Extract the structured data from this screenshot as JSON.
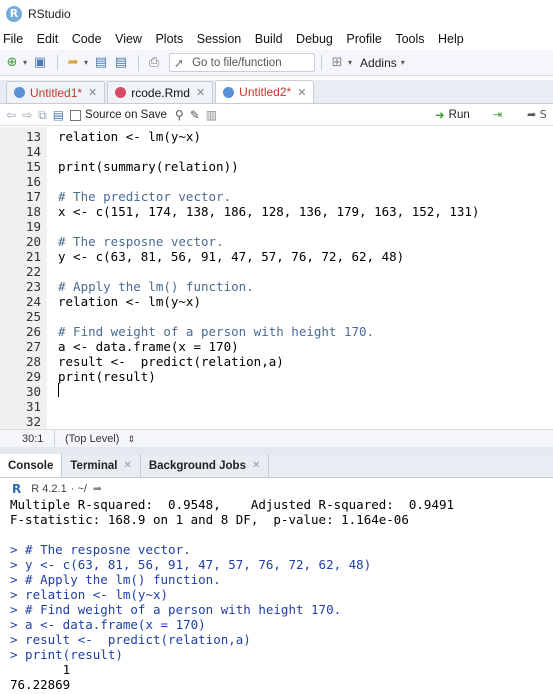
{
  "window": {
    "title": "RStudio"
  },
  "menu": [
    "File",
    "Edit",
    "Code",
    "View",
    "Plots",
    "Session",
    "Build",
    "Debug",
    "Profile",
    "Tools",
    "Help"
  ],
  "toolbar": {
    "goto_placeholder": "Go to file/function",
    "addins_label": "Addins"
  },
  "editor_tabs": [
    {
      "label": "Untitled1*",
      "modified": true
    },
    {
      "label": "rcode.Rmd",
      "modified": false
    },
    {
      "label": "Untitled2*",
      "modified": true
    }
  ],
  "editor_toolbar": {
    "source_on_save": "Source on Save",
    "run_label": "Run",
    "source_label": "S"
  },
  "code_lines": [
    {
      "n": "13",
      "text": "relation <- lm(y~x)",
      "kind": "code"
    },
    {
      "n": "14",
      "text": "",
      "kind": "code"
    },
    {
      "n": "15",
      "text": "print(summary(relation))",
      "kind": "code"
    },
    {
      "n": "16",
      "text": "",
      "kind": "code"
    },
    {
      "n": "17",
      "text": "# The predictor vector.",
      "kind": "comment"
    },
    {
      "n": "18",
      "text": "x <- c(151, 174, 138, 186, 128, 136, 179, 163, 152, 131)",
      "kind": "code"
    },
    {
      "n": "19",
      "text": "",
      "kind": "code"
    },
    {
      "n": "20",
      "text": "# The resposne vector.",
      "kind": "comment"
    },
    {
      "n": "21",
      "text": "y <- c(63, 81, 56, 91, 47, 57, 76, 72, 62, 48)",
      "kind": "code"
    },
    {
      "n": "22",
      "text": "",
      "kind": "code"
    },
    {
      "n": "23",
      "text": "# Apply the lm() function.",
      "kind": "comment"
    },
    {
      "n": "24",
      "text": "relation <- lm(y~x)",
      "kind": "code"
    },
    {
      "n": "25",
      "text": "",
      "kind": "code"
    },
    {
      "n": "26",
      "text": "# Find weight of a person with height 170.",
      "kind": "comment"
    },
    {
      "n": "27",
      "text": "a <- data.frame(x = 170)",
      "kind": "code"
    },
    {
      "n": "28",
      "text": "result <-  predict(relation,a)",
      "kind": "code"
    },
    {
      "n": "29",
      "text": "print(result)",
      "kind": "code"
    },
    {
      "n": "30",
      "text": "",
      "kind": "code"
    },
    {
      "n": "31",
      "text": "",
      "kind": "code"
    },
    {
      "n": "32",
      "text": "",
      "kind": "code"
    }
  ],
  "editor_status": {
    "cursor_pos": "30:1",
    "scope": "(Top Level)"
  },
  "console_tabs": [
    {
      "label": "Console",
      "closable": false
    },
    {
      "label": "Terminal",
      "closable": true
    },
    {
      "label": "Background Jobs",
      "closable": true
    }
  ],
  "console_header": {
    "version": "R 4.2.1",
    "dir": "· ~/"
  },
  "console_lines": [
    {
      "text": "Multiple R-squared:  0.9548,\tAdjusted R-squared:  0.9491",
      "kind": "out"
    },
    {
      "text": "F-statistic: 168.9 on 1 and 8 DF,  p-value: 1.164e-06",
      "kind": "out"
    },
    {
      "text": "",
      "kind": "out"
    },
    {
      "text": "> # The resposne vector.",
      "kind": "in"
    },
    {
      "text": "> y <- c(63, 81, 56, 91, 47, 57, 76, 72, 62, 48)",
      "kind": "in"
    },
    {
      "text": "> # Apply the lm() function.",
      "kind": "in"
    },
    {
      "text": "> relation <- lm(y~x)",
      "kind": "in"
    },
    {
      "text": "> # Find weight of a person with height 170.",
      "kind": "in"
    },
    {
      "text": "> a <- data.frame(x = 170)",
      "kind": "in"
    },
    {
      "text": "> result <-  predict(relation,a)",
      "kind": "in"
    },
    {
      "text": "> print(result)",
      "kind": "in"
    },
    {
      "text": "       1",
      "kind": "out"
    },
    {
      "text": "76.22869",
      "kind": "out"
    }
  ]
}
